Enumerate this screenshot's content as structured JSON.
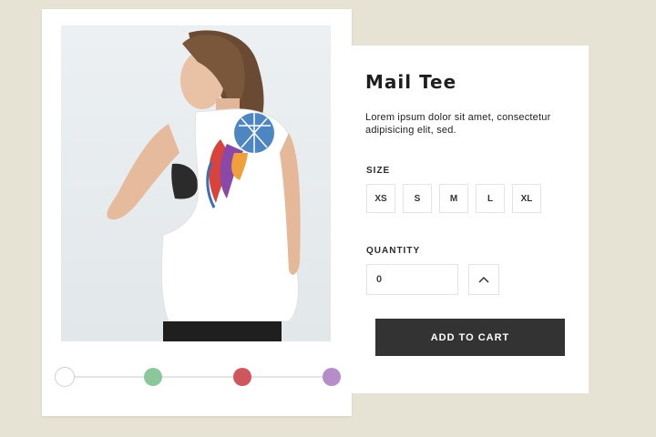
{
  "product": {
    "title": "Mail Tee",
    "description": "Lorem ipsum dolor sit amet, consectetur adipisicing elit, sed.",
    "image_alt": "model-wearing-white-tank-top"
  },
  "size": {
    "label": "SIZE",
    "options": [
      "XS",
      "S",
      "M",
      "L",
      "XL"
    ]
  },
  "quantity": {
    "label": "QUANTITY",
    "value": "0"
  },
  "cart": {
    "button_label": "ADD TO CART"
  },
  "colors": {
    "swatches": [
      {
        "name": "white",
        "hex": "#ffffff"
      },
      {
        "name": "green",
        "hex": "#8cc79c"
      },
      {
        "name": "red",
        "hex": "#cf565d"
      },
      {
        "name": "purple",
        "hex": "#b68cc9"
      }
    ],
    "page_background": "#e6e2d4",
    "button_background": "#333333"
  },
  "icons": {
    "quantity_increase": "chevron-up-icon"
  }
}
